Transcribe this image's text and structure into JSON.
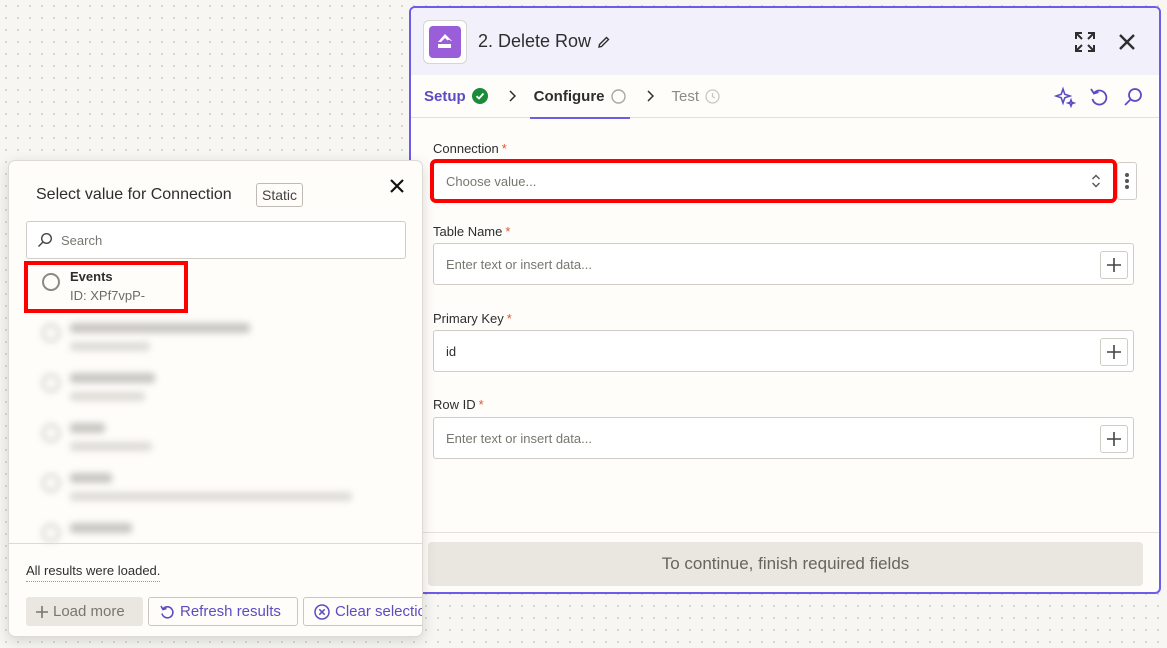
{
  "panel": {
    "title": "2. Delete Row",
    "tabs": [
      {
        "label": "Setup",
        "status": "complete"
      },
      {
        "label": "Configure",
        "status": "active"
      },
      {
        "label": "Test",
        "status": "pending"
      }
    ],
    "fields": {
      "connection": {
        "label": "Connection",
        "required": "*",
        "placeholder": "Choose value..."
      },
      "table_name": {
        "label": "Table Name",
        "required": "*",
        "placeholder": "Enter text or insert data..."
      },
      "primary_key": {
        "label": "Primary Key",
        "required": "*",
        "value": "id"
      },
      "row_id": {
        "label": "Row ID",
        "required": "*",
        "placeholder": "Enter text or insert data..."
      }
    },
    "continue_label": "To continue, finish required fields",
    "icons": [
      "edit-icon",
      "expand-icon",
      "close-icon",
      "check-circle-icon",
      "chevron-right-icon",
      "sparkle-icon",
      "undo-icon",
      "search-icon",
      "plus-icon",
      "kebab-icon",
      "updown-icon"
    ],
    "colors": {
      "accent": "#6c5ce7",
      "success": "#1b8a3a",
      "required": "#e0552f",
      "highlight": "#ff0000"
    }
  },
  "popover": {
    "title": "Select value for Connection",
    "badge": "Static",
    "search_placeholder": "Search",
    "options": [
      {
        "name": "Events",
        "id": "ID: XPf7vpP-"
      }
    ],
    "status": "All results were loaded.",
    "buttons": {
      "load_more": "Load more",
      "refresh": "Refresh results",
      "clear": "Clear selection"
    }
  }
}
